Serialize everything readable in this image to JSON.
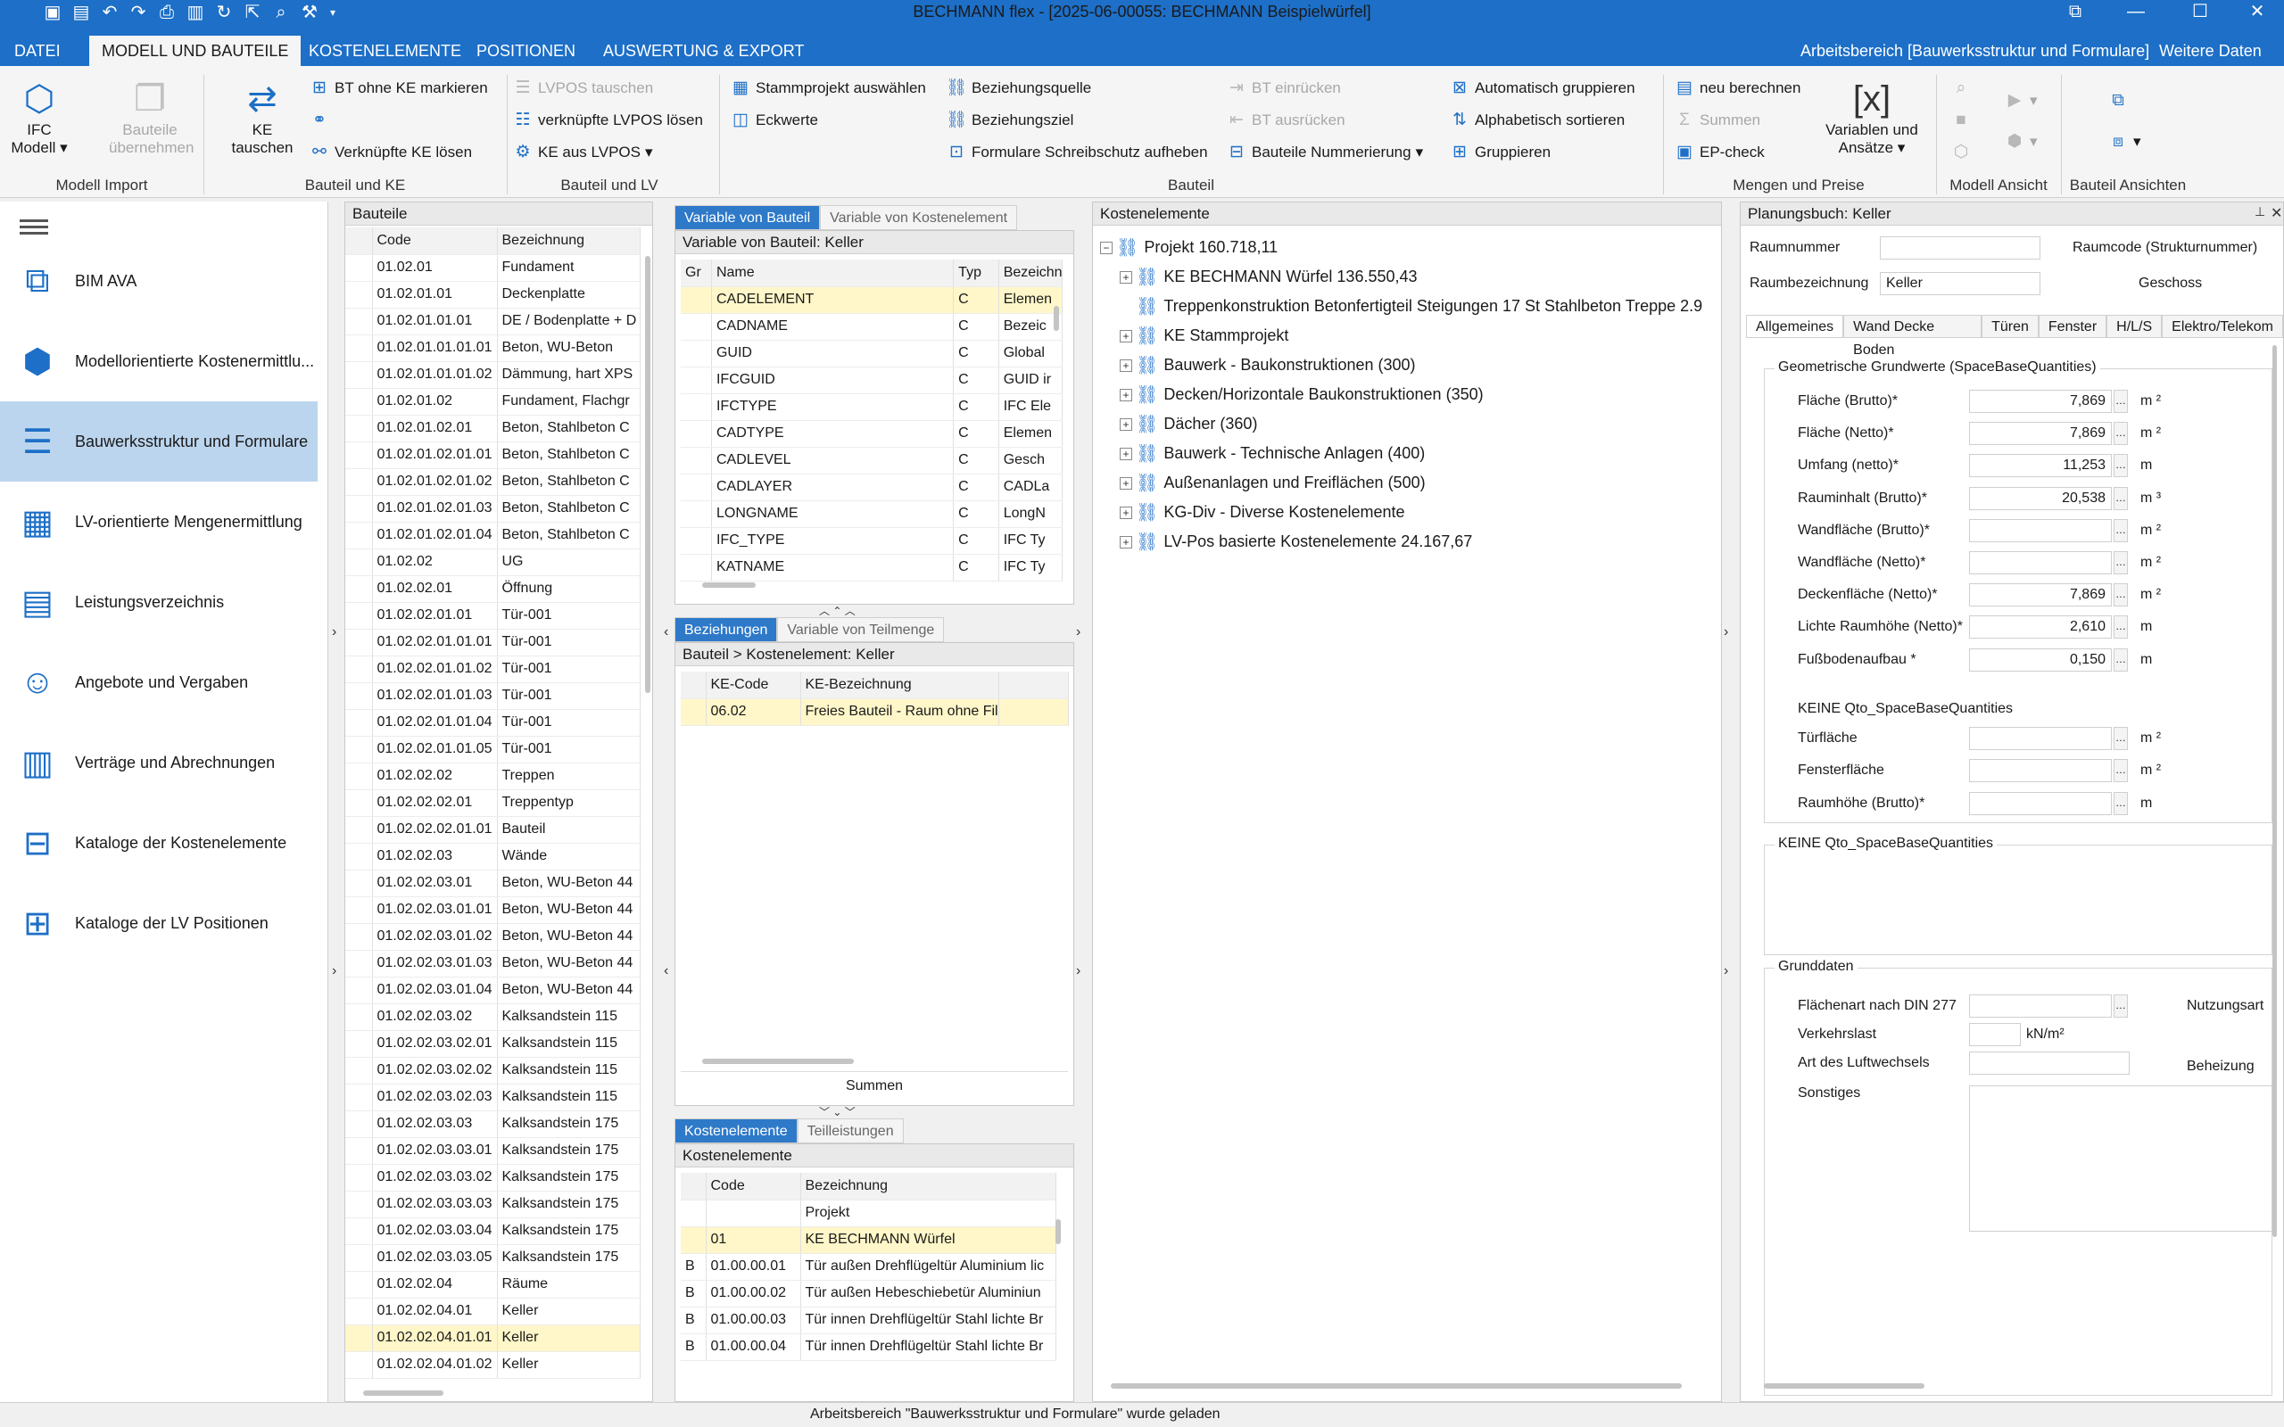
{
  "window": {
    "title": "BECHMANN flex - [2025-06-00055: BECHMANN Beispielwürfel]"
  },
  "menu": {
    "datei": "DATEI",
    "modell": "MODELL UND BAUTEILE",
    "kosten": "KOSTENELEMENTE",
    "positionen": "POSITIONEN",
    "auswertung": "AUSWERTUNG & EXPORT",
    "arbeitsbereich": "Arbeitsbereich [Bauwerksstruktur und Formulare]",
    "weitere": "Weitere Daten"
  },
  "ribbon": {
    "ifc_modell": "IFC Modell",
    "bauteile_uebernehmen": "Bauteile übernehmen",
    "ke_tauschen": "KE tauschen",
    "bt_ohne_ke": "BT ohne KE markieren",
    "verknuepfte_ke_loesen": "Verknüpfte KE lösen",
    "lvpos_tauschen": "LVPOS tauschen",
    "verknuepfte_lvpos_loesen": "verknüpfte LVPOS lösen",
    "ke_aus_lvpos": "KE aus LVPOS",
    "stammprojekt": "Stammprojekt auswählen",
    "eckwerte": "Eckwerte",
    "beziehungsquelle": "Beziehungsquelle",
    "beziehungsziel": "Beziehungsziel",
    "formulare_schreibschutz": "Formulare Schreibschutz aufheben",
    "bt_einruecken": "BT einrücken",
    "bt_ausruecken": "BT ausrücken",
    "bauteile_nummerierung": "Bauteile Nummerierung",
    "auto_gruppieren": "Automatisch gruppieren",
    "alpha_sortieren": "Alphabetisch sortieren",
    "gruppieren": "Gruppieren",
    "neu_berechnen": "neu berechnen",
    "summen": "Summen",
    "ep_check": "EP-check",
    "variablen": "Variablen und Ansätze",
    "grp_modell_import": "Modell Import",
    "grp_bauteil_ke": "Bauteil und KE",
    "grp_bauteil_lv": "Bauteil und LV",
    "grp_bauteil": "Bauteil",
    "grp_mengen": "Mengen und Preise",
    "grp_modell_ansicht": "Modell Ansicht",
    "grp_bauteil_ansichten": "Bauteil Ansichten"
  },
  "nav": [
    {
      "label": "BIM AVA",
      "icon": "bim-ava-icon"
    },
    {
      "label": "Modellorientierte Kostenermittlu...",
      "icon": "model-cost-icon"
    },
    {
      "label": "Bauwerksstruktur und Formulare",
      "icon": "structure-icon"
    },
    {
      "label": "LV-orientierte Mengenermittlung",
      "icon": "lv-quantity-icon"
    },
    {
      "label": "Leistungsverzeichnis",
      "icon": "lv-icon"
    },
    {
      "label": "Angebote und Vergaben",
      "icon": "offers-icon"
    },
    {
      "label": "Verträge und Abrechnungen",
      "icon": "contracts-icon"
    },
    {
      "label": "Kataloge der Kostenelemente",
      "icon": "ke-catalog-icon"
    },
    {
      "label": "Kataloge der LV Positionen",
      "icon": "lv-catalog-icon"
    }
  ],
  "bauteile": {
    "title": "Bauteile",
    "col_code": "Code",
    "col_bez": "Bezeichnung",
    "rows": [
      [
        "01.02.01",
        "Fundament"
      ],
      [
        "01.02.01.01",
        "Deckenplatte"
      ],
      [
        "01.02.01.01.01",
        "DE / Bodenplatte + D"
      ],
      [
        "01.02.01.01.01.01",
        "Beton, WU-Beton"
      ],
      [
        "01.02.01.01.01.02",
        "Dämmung, hart XPS"
      ],
      [
        "01.02.01.02",
        "Fundament, Flachgr"
      ],
      [
        "01.02.01.02.01",
        "Beton, Stahlbeton C"
      ],
      [
        "01.02.01.02.01.01",
        "Beton, Stahlbeton C"
      ],
      [
        "01.02.01.02.01.02",
        "Beton, Stahlbeton C"
      ],
      [
        "01.02.01.02.01.03",
        "Beton, Stahlbeton C"
      ],
      [
        "01.02.01.02.01.04",
        "Beton, Stahlbeton C"
      ],
      [
        "01.02.02",
        "UG"
      ],
      [
        "01.02.02.01",
        "Öffnung"
      ],
      [
        "01.02.02.01.01",
        "Tür-001"
      ],
      [
        "01.02.02.01.01.01",
        "Tür-001"
      ],
      [
        "01.02.02.01.01.02",
        "Tür-001"
      ],
      [
        "01.02.02.01.01.03",
        "Tür-001"
      ],
      [
        "01.02.02.01.01.04",
        "Tür-001"
      ],
      [
        "01.02.02.01.01.05",
        "Tür-001"
      ],
      [
        "01.02.02.02",
        "Treppen"
      ],
      [
        "01.02.02.02.01",
        "Treppentyp"
      ],
      [
        "01.02.02.02.01.01",
        "Bauteil"
      ],
      [
        "01.02.02.03",
        "Wände"
      ],
      [
        "01.02.02.03.01",
        "Beton, WU-Beton 44"
      ],
      [
        "01.02.02.03.01.01",
        "Beton, WU-Beton 44"
      ],
      [
        "01.02.02.03.01.02",
        "Beton, WU-Beton 44"
      ],
      [
        "01.02.02.03.01.03",
        "Beton, WU-Beton 44"
      ],
      [
        "01.02.02.03.01.04",
        "Beton, WU-Beton 44"
      ],
      [
        "01.02.02.03.02",
        "Kalksandstein 115"
      ],
      [
        "01.02.02.03.02.01",
        "Kalksandstein 115"
      ],
      [
        "01.02.02.03.02.02",
        "Kalksandstein 115"
      ],
      [
        "01.02.02.03.02.03",
        "Kalksandstein 115"
      ],
      [
        "01.02.02.03.03",
        "Kalksandstein 175"
      ],
      [
        "01.02.02.03.03.01",
        "Kalksandstein 175"
      ],
      [
        "01.02.02.03.03.02",
        "Kalksandstein 175"
      ],
      [
        "01.02.02.03.03.03",
        "Kalksandstein 175"
      ],
      [
        "01.02.02.03.03.04",
        "Kalksandstein 175"
      ],
      [
        "01.02.02.03.03.05",
        "Kalksandstein 175"
      ],
      [
        "01.02.02.04",
        "Räume"
      ],
      [
        "01.02.02.04.01",
        "Keller"
      ],
      [
        "01.02.02.04.01.01",
        "Keller"
      ],
      [
        "01.02.02.04.01.02",
        "Keller"
      ]
    ]
  },
  "variablen": {
    "tab1": "Variable von Bauteil",
    "tab2": "Variable von Kostenelement",
    "header": "Variable von Bauteil: Keller",
    "col_gr": "Gr",
    "col_name": "Name",
    "col_typ": "Typ",
    "col_bez": "Bezeichnu",
    "rows": [
      [
        "CADELEMENT",
        "C",
        "Elemen"
      ],
      [
        "CADNAME",
        "C",
        "Bezeic"
      ],
      [
        "GUID",
        "C",
        "Global"
      ],
      [
        "IFCGUID",
        "C",
        "GUID ir"
      ],
      [
        "IFCTYPE",
        "C",
        "IFC Ele"
      ],
      [
        "CADTYPE",
        "C",
        "Elemen"
      ],
      [
        "CADLEVEL",
        "C",
        "Gesch"
      ],
      [
        "CADLAYER",
        "C",
        "CADLa"
      ],
      [
        "LONGNAME",
        "C",
        "LongN"
      ],
      [
        "IFC_TYPE",
        "C",
        "IFC Ty"
      ],
      [
        "KATNAME",
        "C",
        "IFC Ty"
      ]
    ]
  },
  "beziehungen": {
    "tab1": "Beziehungen",
    "tab2": "Variable von Teilmenge",
    "header": "Bauteil > Kostenelement: Keller",
    "col_code": "KE-Code",
    "col_bez": "KE-Bezeichnung",
    "rows": [
      [
        "06.02",
        "Freies Bauteil - Raum ohne Fil"
      ]
    ],
    "summen": "Summen"
  },
  "kostenelemente_bottom": {
    "tab1": "Kostenelemente",
    "tab2": "Teilleistungen",
    "header": "Kostenelemente",
    "col_code": "Code",
    "col_bez": "Bezeichnung",
    "rows": [
      [
        "",
        "",
        "Projekt"
      ],
      [
        "",
        "01",
        "KE BECHMANN Würfel"
      ],
      [
        "B",
        "01.00.00.01",
        "Tür außen Drehflügeltür Aluminium lic"
      ],
      [
        "B",
        "01.00.00.02",
        "Tür außen Hebeschiebetür Aluminiun"
      ],
      [
        "B",
        "01.00.00.03",
        "Tür innen Drehflügeltür Stahl lichte Br"
      ],
      [
        "B",
        "01.00.00.04",
        "Tür innen Drehflügeltür Stahl lichte Br"
      ]
    ]
  },
  "tree": {
    "title": "Kostenelemente",
    "rows": [
      {
        "text": "Projekt  160.718,11",
        "level": 0
      },
      {
        "text": "KE BECHMANN Würfel  136.550,43",
        "level": 1
      },
      {
        "text": "Treppenkonstruktion Betonfertigteil Steigungen 17 St Stahlbeton Treppe  2.9",
        "level": 1
      },
      {
        "text": "KE Stammprojekt",
        "level": 1
      },
      {
        "text": "Bauwerk - Baukonstruktionen (300)",
        "level": 1
      },
      {
        "text": "Decken/Horizontale Baukonstruktionen (350)",
        "level": 1
      },
      {
        "text": "Dächer (360)",
        "level": 1
      },
      {
        "text": "Bauwerk - Technische Anlagen (400)",
        "level": 1
      },
      {
        "text": "Außenanlagen und Freiflächen (500)",
        "level": 1
      },
      {
        "text": "KG-Div - Diverse Kostenelemente",
        "level": 1
      },
      {
        "text": "LV-Pos basierte Kostenelemente  24.167,67",
        "level": 1
      }
    ]
  },
  "planungsbuch": {
    "title": "Planungsbuch: Keller",
    "raumnummer": "Raumnummer",
    "raumcode": "Raumcode (Strukturnummer)",
    "raumbez": "Raumbezeichnung",
    "raumbez_val": "Keller",
    "geschoss": "Geschoss",
    "tabs": [
      "Allgemeines",
      "Wand Decke Boden",
      "Türen",
      "Fenster",
      "H/L/S",
      "Elektro/Telekom"
    ],
    "geo_title": "Geometrische Grundwerte (SpaceBaseQuantities)",
    "geo": [
      {
        "label": "Fläche (Brutto)*",
        "value": "7,869",
        "unit": "m ²"
      },
      {
        "label": "Fläche (Netto)*",
        "value": "7,869",
        "unit": "m ²"
      },
      {
        "label": "Umfang (netto)*",
        "value": "11,253",
        "unit": "m"
      },
      {
        "label": "Rauminhalt (Brutto)*",
        "value": "20,538",
        "unit": "m ³"
      },
      {
        "label": "Wandfläche (Brutto)*",
        "value": "",
        "unit": "m ²"
      },
      {
        "label": "Wandfläche (Netto)*",
        "value": "",
        "unit": "m ²"
      },
      {
        "label": "Deckenfläche (Netto)*",
        "value": "7,869",
        "unit": "m ²"
      },
      {
        "label": "Lichte Raumhöhe (Netto)*",
        "value": "2,610",
        "unit": "m"
      },
      {
        "label": "Fußbodenaufbau *",
        "value": "0,150",
        "unit": "m"
      }
    ],
    "keine1": "KEINE Qto_SpaceBaseQuantities",
    "geo2": [
      {
        "label": "Türfläche",
        "value": "",
        "unit": "m ²"
      },
      {
        "label": "Fensterfläche",
        "value": "",
        "unit": "m ²"
      },
      {
        "label": "Raumhöhe (Brutto)*",
        "value": "",
        "unit": "m"
      }
    ],
    "keine2": "KEINE Qto_SpaceBaseQuantities",
    "grund_title": "Grunddaten",
    "flaechenart": "Flächenart nach DIN 277",
    "nutzungsart": "Nutzungsart",
    "verkehrslast": "Verkehrslast",
    "verkehrslast_unit": "kN/m²",
    "luftwechsel": "Art des Luftwechsels",
    "beheizung": "Beheizung",
    "sonstiges": "Sonstiges"
  },
  "status": {
    "message": "Arbeitsbereich \"Bauwerksstruktur und Formulare\" wurde geladen"
  }
}
